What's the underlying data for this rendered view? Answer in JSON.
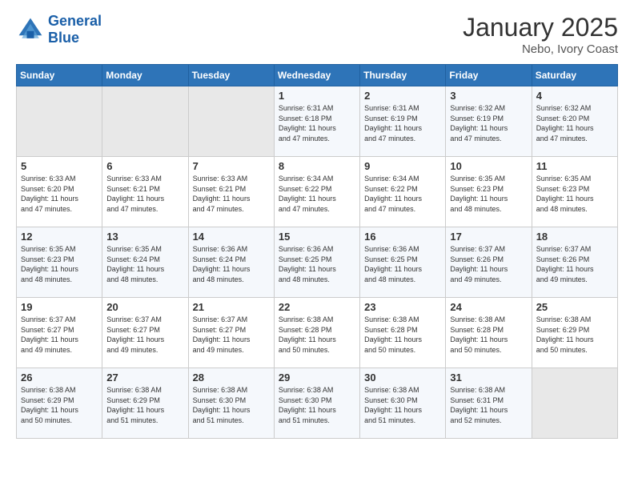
{
  "header": {
    "logo_line1": "General",
    "logo_line2": "Blue",
    "title": "January 2025",
    "location": "Nebo, Ivory Coast"
  },
  "days_of_week": [
    "Sunday",
    "Monday",
    "Tuesday",
    "Wednesday",
    "Thursday",
    "Friday",
    "Saturday"
  ],
  "weeks": [
    [
      {
        "day": "",
        "info": ""
      },
      {
        "day": "",
        "info": ""
      },
      {
        "day": "",
        "info": ""
      },
      {
        "day": "1",
        "info": "Sunrise: 6:31 AM\nSunset: 6:18 PM\nDaylight: 11 hours\nand 47 minutes."
      },
      {
        "day": "2",
        "info": "Sunrise: 6:31 AM\nSunset: 6:19 PM\nDaylight: 11 hours\nand 47 minutes."
      },
      {
        "day": "3",
        "info": "Sunrise: 6:32 AM\nSunset: 6:19 PM\nDaylight: 11 hours\nand 47 minutes."
      },
      {
        "day": "4",
        "info": "Sunrise: 6:32 AM\nSunset: 6:20 PM\nDaylight: 11 hours\nand 47 minutes."
      }
    ],
    [
      {
        "day": "5",
        "info": "Sunrise: 6:33 AM\nSunset: 6:20 PM\nDaylight: 11 hours\nand 47 minutes."
      },
      {
        "day": "6",
        "info": "Sunrise: 6:33 AM\nSunset: 6:21 PM\nDaylight: 11 hours\nand 47 minutes."
      },
      {
        "day": "7",
        "info": "Sunrise: 6:33 AM\nSunset: 6:21 PM\nDaylight: 11 hours\nand 47 minutes."
      },
      {
        "day": "8",
        "info": "Sunrise: 6:34 AM\nSunset: 6:22 PM\nDaylight: 11 hours\nand 47 minutes."
      },
      {
        "day": "9",
        "info": "Sunrise: 6:34 AM\nSunset: 6:22 PM\nDaylight: 11 hours\nand 47 minutes."
      },
      {
        "day": "10",
        "info": "Sunrise: 6:35 AM\nSunset: 6:23 PM\nDaylight: 11 hours\nand 48 minutes."
      },
      {
        "day": "11",
        "info": "Sunrise: 6:35 AM\nSunset: 6:23 PM\nDaylight: 11 hours\nand 48 minutes."
      }
    ],
    [
      {
        "day": "12",
        "info": "Sunrise: 6:35 AM\nSunset: 6:23 PM\nDaylight: 11 hours\nand 48 minutes."
      },
      {
        "day": "13",
        "info": "Sunrise: 6:35 AM\nSunset: 6:24 PM\nDaylight: 11 hours\nand 48 minutes."
      },
      {
        "day": "14",
        "info": "Sunrise: 6:36 AM\nSunset: 6:24 PM\nDaylight: 11 hours\nand 48 minutes."
      },
      {
        "day": "15",
        "info": "Sunrise: 6:36 AM\nSunset: 6:25 PM\nDaylight: 11 hours\nand 48 minutes."
      },
      {
        "day": "16",
        "info": "Sunrise: 6:36 AM\nSunset: 6:25 PM\nDaylight: 11 hours\nand 48 minutes."
      },
      {
        "day": "17",
        "info": "Sunrise: 6:37 AM\nSunset: 6:26 PM\nDaylight: 11 hours\nand 49 minutes."
      },
      {
        "day": "18",
        "info": "Sunrise: 6:37 AM\nSunset: 6:26 PM\nDaylight: 11 hours\nand 49 minutes."
      }
    ],
    [
      {
        "day": "19",
        "info": "Sunrise: 6:37 AM\nSunset: 6:27 PM\nDaylight: 11 hours\nand 49 minutes."
      },
      {
        "day": "20",
        "info": "Sunrise: 6:37 AM\nSunset: 6:27 PM\nDaylight: 11 hours\nand 49 minutes."
      },
      {
        "day": "21",
        "info": "Sunrise: 6:37 AM\nSunset: 6:27 PM\nDaylight: 11 hours\nand 49 minutes."
      },
      {
        "day": "22",
        "info": "Sunrise: 6:38 AM\nSunset: 6:28 PM\nDaylight: 11 hours\nand 50 minutes."
      },
      {
        "day": "23",
        "info": "Sunrise: 6:38 AM\nSunset: 6:28 PM\nDaylight: 11 hours\nand 50 minutes."
      },
      {
        "day": "24",
        "info": "Sunrise: 6:38 AM\nSunset: 6:28 PM\nDaylight: 11 hours\nand 50 minutes."
      },
      {
        "day": "25",
        "info": "Sunrise: 6:38 AM\nSunset: 6:29 PM\nDaylight: 11 hours\nand 50 minutes."
      }
    ],
    [
      {
        "day": "26",
        "info": "Sunrise: 6:38 AM\nSunset: 6:29 PM\nDaylight: 11 hours\nand 50 minutes."
      },
      {
        "day": "27",
        "info": "Sunrise: 6:38 AM\nSunset: 6:29 PM\nDaylight: 11 hours\nand 51 minutes."
      },
      {
        "day": "28",
        "info": "Sunrise: 6:38 AM\nSunset: 6:30 PM\nDaylight: 11 hours\nand 51 minutes."
      },
      {
        "day": "29",
        "info": "Sunrise: 6:38 AM\nSunset: 6:30 PM\nDaylight: 11 hours\nand 51 minutes."
      },
      {
        "day": "30",
        "info": "Sunrise: 6:38 AM\nSunset: 6:30 PM\nDaylight: 11 hours\nand 51 minutes."
      },
      {
        "day": "31",
        "info": "Sunrise: 6:38 AM\nSunset: 6:31 PM\nDaylight: 11 hours\nand 52 minutes."
      },
      {
        "day": "",
        "info": ""
      }
    ]
  ]
}
